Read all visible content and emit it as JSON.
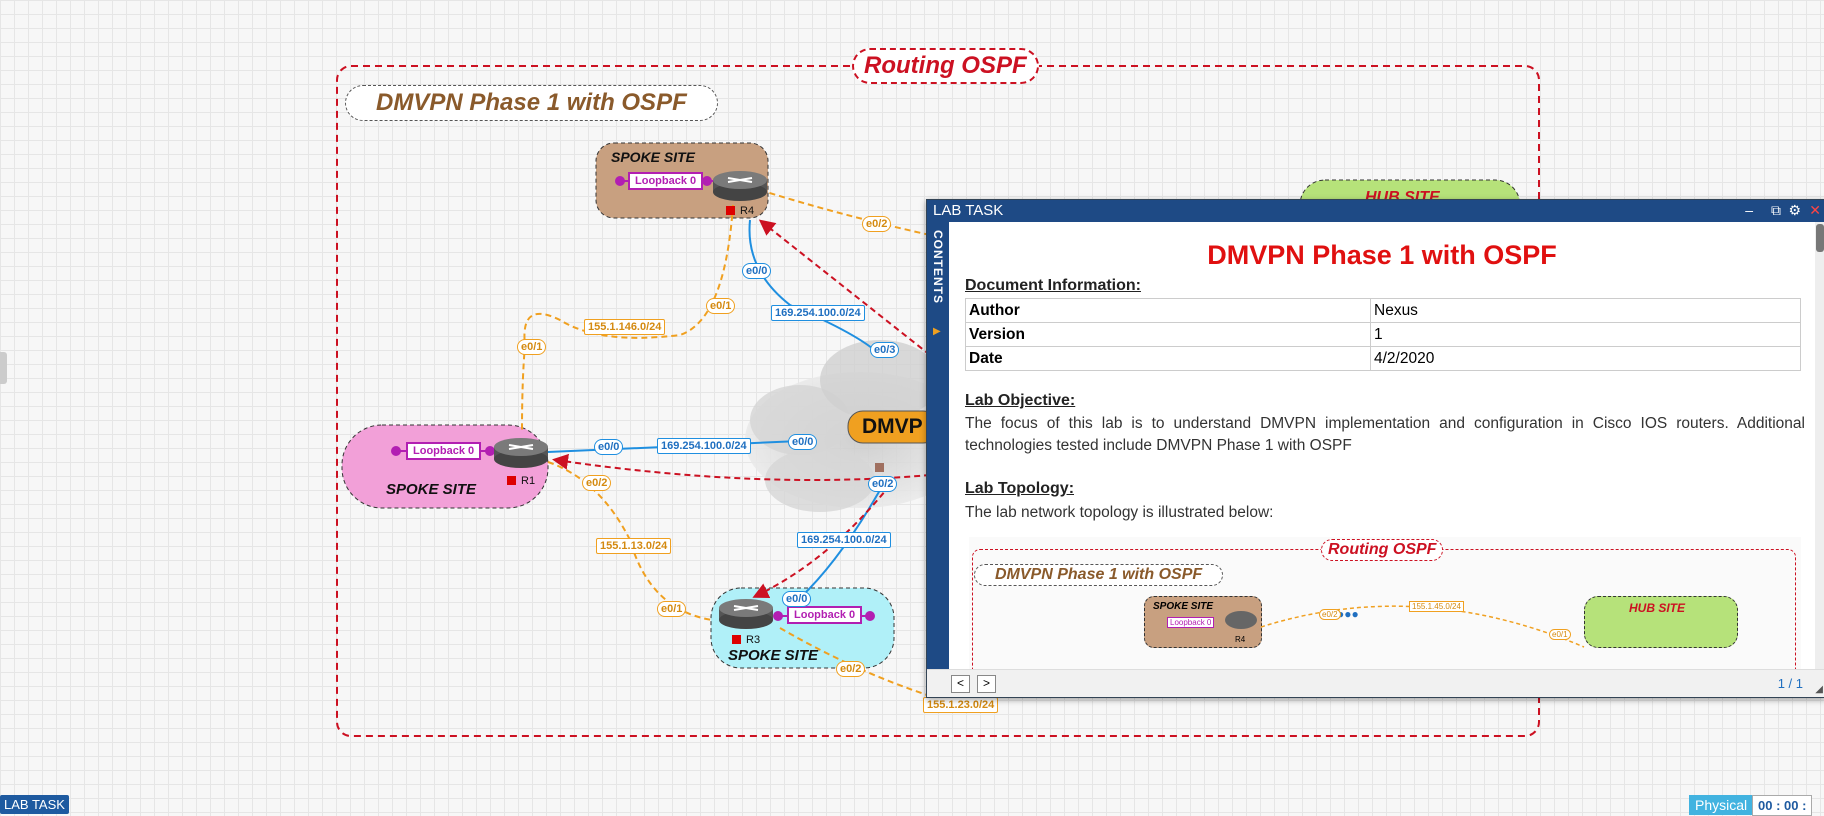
{
  "topology": {
    "title": "Routing OSPF",
    "subtitle": "DMVPN Phase 1 with OSPF",
    "sites": {
      "r4": "SPOKE SITE",
      "r1": "SPOKE SITE",
      "r3": "SPOKE SITE",
      "hub": "HUB SITE"
    },
    "cloud_label": "DMVP",
    "routers": {
      "r4": "R4",
      "r1": "R1",
      "r3": "R3"
    },
    "loopback": "Loopback 0",
    "interfaces": {
      "r4_e0_2": "e0/2",
      "r4_e0_0": "e0/0",
      "r4_e0_1": "e0/1",
      "r1_e0_1": "e0/1",
      "r1_e0_0": "e0/0",
      "r1_e0_2": "e0/2",
      "r3_e0_1": "e0/1",
      "r3_e0_0": "e0/0",
      "r3_e0_2": "e0/2",
      "hub_e0_3": "e0/3",
      "hub_e0_0": "e0/0",
      "hub_e0_2": "e0/2"
    },
    "subnets": {
      "r4_r1_orange": "155.1.146.0/24",
      "r4_hub_blue": "169.254.100.0/24",
      "r1_hub_blue": "169.254.100.0/24",
      "r3_hub_blue": "169.254.100.0/24",
      "r1_r3_orange": "155.1.13.0/24",
      "r3_hub_orange": "155.1.23.0/24"
    }
  },
  "lab_window": {
    "title": "LAB TASK",
    "contents_tab": "CONTENTS",
    "heading": "DMVPN Phase 1 with OSPF",
    "document_info_label": "Document Information:",
    "info_rows": [
      {
        "key": "Author",
        "value": "Nexus"
      },
      {
        "key": "Version",
        "value": "1"
      },
      {
        "key": "Date",
        "value": "4/2/2020"
      }
    ],
    "objective_label": "Lab Objective:",
    "objective_text": "The focus of this lab is to understand DMVPN implementation and configuration in Cisco IOS routers. Additional technologies tested include DMVPN Phase 1 with OSPF",
    "topology_label": "Lab Topology:",
    "topology_text": "The lab network topology is illustrated below:",
    "thumbnail": {
      "title": "Routing OSPF",
      "subtitle": "DMVPN Phase 1 with OSPF",
      "spoke": "SPOKE SITE",
      "hub": "HUB SITE",
      "loopback": "Loopback 0",
      "router": "R4",
      "if_a": "e0/2",
      "if_b": "e0/1",
      "subnet": "155.1.45.0/24"
    },
    "page_indicator": "1 / 1",
    "prev": "<",
    "next": ">"
  },
  "bottom_bar": {
    "lab_task_button": "LAB TASK",
    "physical_button": "Physical",
    "timer": "00 : 00 :"
  },
  "colors": {
    "title_red": "#cc1122",
    "subtitle_brown": "#8a5a2b",
    "window_blue": "#1e4a85",
    "spoke_r4": "#c8a080",
    "spoke_r1": "#f2a0d8",
    "spoke_r3": "#b0f0f8",
    "hub_green": "#b6e27a",
    "link_blue": "#1f8fe0",
    "link_orange": "#f0a020"
  }
}
